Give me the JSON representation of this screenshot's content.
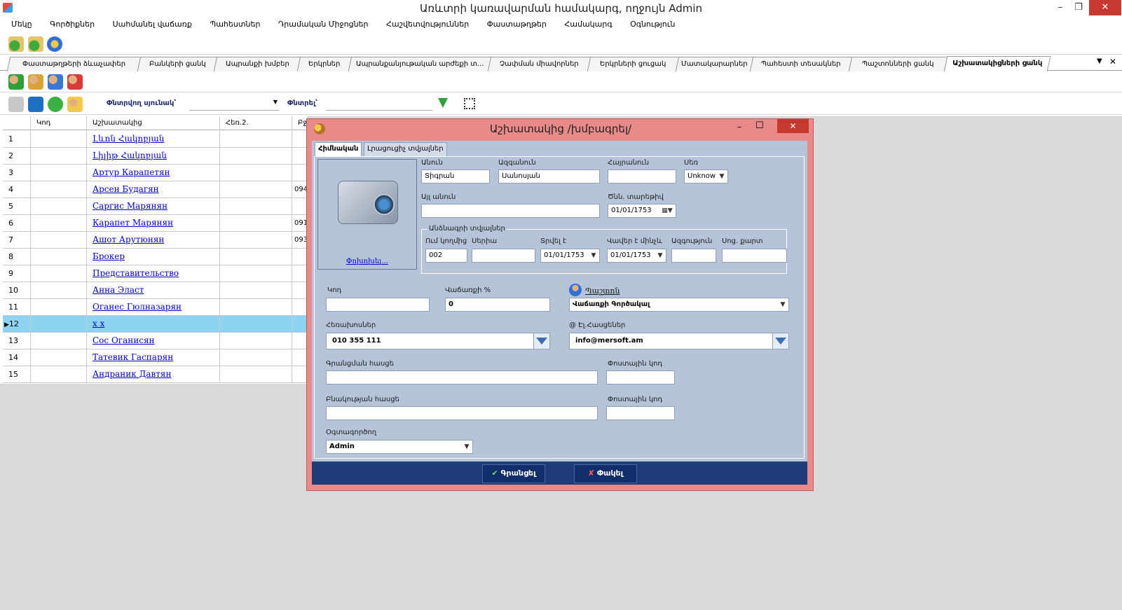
{
  "window": {
    "title": "Առևտրի կառավարման համակարգ, ողջույն Admin",
    "minimize": "–",
    "restore": "❐",
    "close": "✕"
  },
  "menu": [
    "Մեկը",
    "Գործիքներ",
    "Սահմանել վաճառք",
    "Պահեստներ",
    "Դրամական Միջոցներ",
    "Հաշվետվություններ",
    "Փաստաթղթեր",
    "Համակարգ",
    "Օգնություն"
  ],
  "tabs": [
    "Փաստաթղթերի ձևաչափեր",
    "Բանկերի ցանկ",
    "Ապրանքի խմբեր",
    "Երկրներ",
    "Ապրանքանյութական արժեքի տ...",
    "Չափման միավորներ",
    "Երկրների ցուցակ",
    "Մատակարարներ",
    "Պահեստի տեսակներ",
    "Պաշտոնների ցանկ",
    "Աշխատակիցների ցանկ"
  ],
  "tabs_controls": {
    "menu": "▼",
    "close": "✕"
  },
  "filter": {
    "column_label": "Փնտրվող սյունակ՝",
    "search_label": "Փնտրել՝"
  },
  "grid": {
    "headers": [
      "Կոդ",
      "Աշխատակից",
      "Հեռ.2.",
      "Բջ"
    ],
    "rows": [
      {
        "num": "1",
        "name": "Լևոն Հակոբյան",
        "phone": ""
      },
      {
        "num": "2",
        "name": "Լիլիթ Հակոբյան",
        "phone": ""
      },
      {
        "num": "3",
        "name": "Артур Карапетян",
        "phone": ""
      },
      {
        "num": "4",
        "name": "Арсен Будагян",
        "phone": "094"
      },
      {
        "num": "5",
        "name": "Саргис Марянян",
        "phone": ""
      },
      {
        "num": "6",
        "name": "Карапет Марянян",
        "phone": "091"
      },
      {
        "num": "7",
        "name": "Ашот Арутюнян",
        "phone": "093"
      },
      {
        "num": "8",
        "name": "Брокер",
        "phone": ""
      },
      {
        "num": "9",
        "name": "Представительство",
        "phone": ""
      },
      {
        "num": "10",
        "name": "Анна Эласт",
        "phone": ""
      },
      {
        "num": "11",
        "name": "Оганес Гюлназарян",
        "phone": ""
      },
      {
        "num": "12",
        "name": "x x",
        "phone": ""
      },
      {
        "num": "13",
        "name": "Сос Оганисян",
        "phone": ""
      },
      {
        "num": "14",
        "name": "Татевик Гаспарян",
        "phone": ""
      },
      {
        "num": "15",
        "name": "Андраник Давтян",
        "phone": ""
      }
    ],
    "selected_marker": "▶"
  },
  "dialog": {
    "title": "Աշխատակից /խմբագրել/",
    "tabs": [
      "Հիմնական",
      "Լրացուցիչ տվյալներ"
    ],
    "photo_link": "Փոխոխել...",
    "fields": {
      "first_name": {
        "label": "Անուն",
        "value": "Տիգրան"
      },
      "last_name": {
        "label": "Ազգանուն",
        "value": "Սանոսյան"
      },
      "patronymic": {
        "label": "Հայրանուն",
        "value": ""
      },
      "gender": {
        "label": "Սեռ",
        "value": "Unknow"
      },
      "other_name": {
        "label": "Այլ անուն",
        "value": ""
      },
      "birth_date": {
        "label": "Ծնն. տարեթիվ",
        "value": "01/01/1753"
      }
    },
    "passport": {
      "legend": "Անձնագրի տվյալներ",
      "by_whom": {
        "label": "Ում կողմից",
        "value": "002"
      },
      "series": {
        "label": "Սերիա",
        "value": ""
      },
      "issued": {
        "label": "Տրվել է",
        "value": "01/01/1753"
      },
      "valid": {
        "label": "Վավեր է մինչև",
        "value": "01/01/1753"
      },
      "nationality": {
        "label": "Ազգություն",
        "value": ""
      },
      "soc_card": {
        "label": "Սոց. քարտ",
        "value": ""
      }
    },
    "code": {
      "label": "Կոդ",
      "value": ""
    },
    "salary_pct": {
      "label": "Վաճառքի %",
      "value": "0"
    },
    "position": {
      "label": "Պաշտոն",
      "value": "Վաճառքի Գործակալ"
    },
    "phones": {
      "label": "Հեռախոսներ",
      "value": "010 355 111"
    },
    "emails": {
      "label": "@ Էլ.Հասցեներ",
      "value": "info@mersoft.am"
    },
    "reg_address": {
      "label": "Գրանցման հասցե",
      "value": ""
    },
    "postal1": {
      "label": "Փոստային կոդ",
      "value": ""
    },
    "res_address": {
      "label": "Բնակության հասցե",
      "value": ""
    },
    "postal2": {
      "label": "Փոստային կոդ",
      "value": ""
    },
    "user": {
      "label": "Օգտագործող",
      "value": "Admin"
    },
    "ok": "Գրանցել",
    "cancel": "Փակել",
    "win_min": "–",
    "win_max": "☐",
    "win_close": "✕"
  },
  "colors": {
    "dialog_frame": "#e8898a",
    "dialog_body": "#b6c4d9",
    "footer": "#1e3c78",
    "selected_row": "#8ed3f2"
  }
}
